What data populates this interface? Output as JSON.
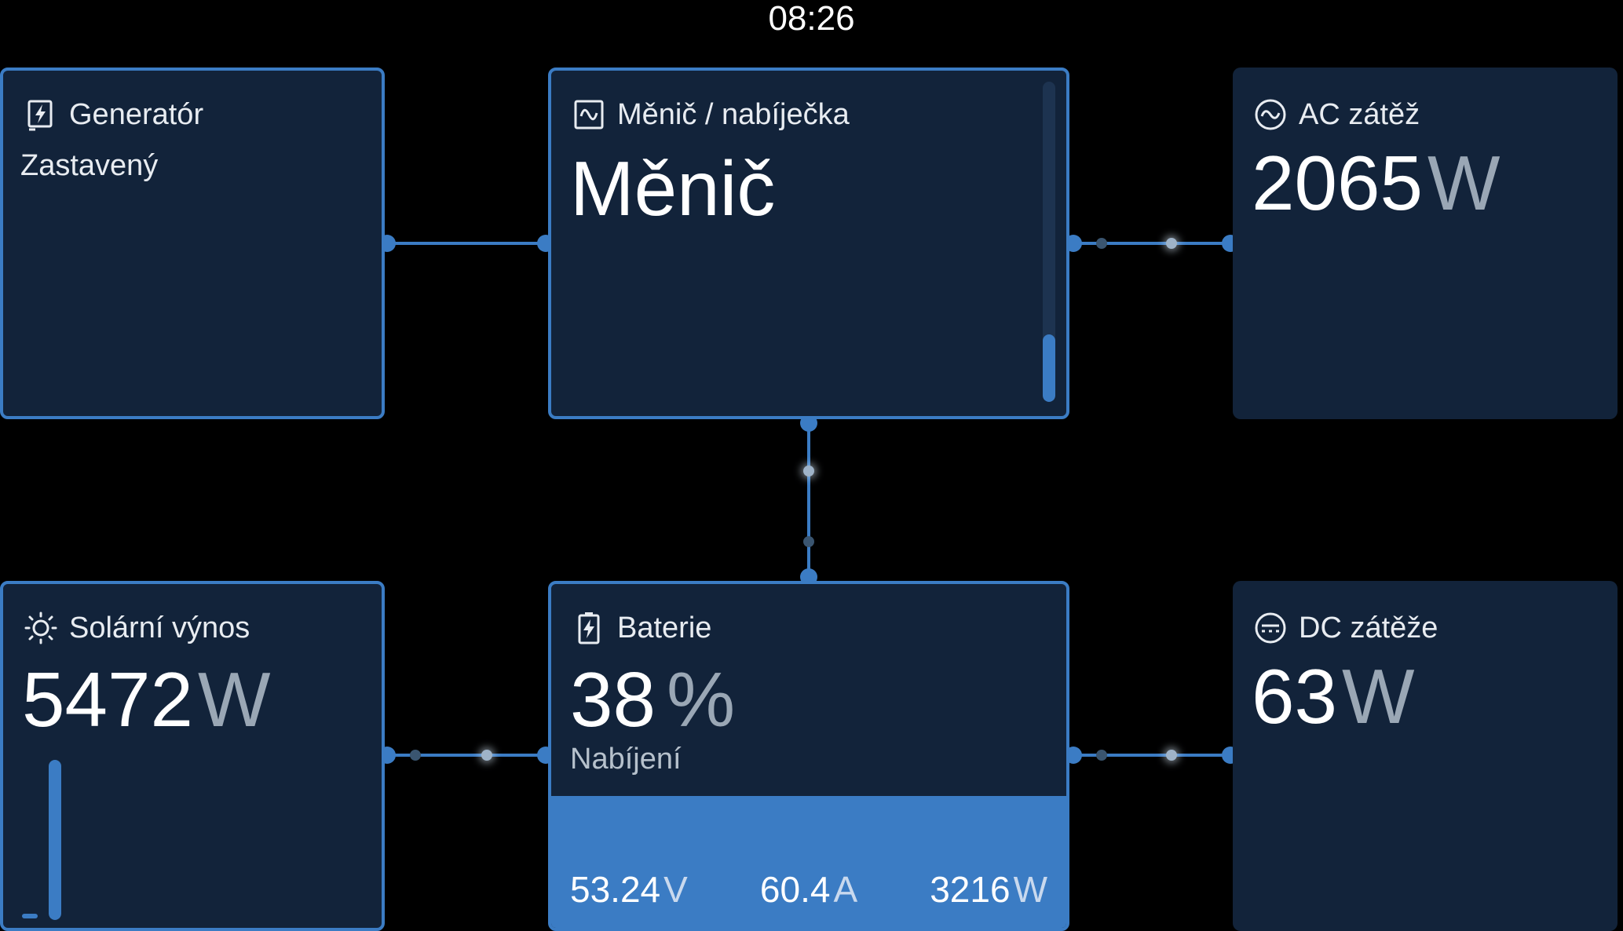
{
  "status_bar": {
    "time": "08:26"
  },
  "generator": {
    "title": "Generatór",
    "icon": "generator-icon",
    "status": "Zastavený"
  },
  "inverter": {
    "title": "Měnič / nabíječka",
    "icon": "inverter-icon",
    "mode": "Měnič",
    "level_fraction": 0.21
  },
  "ac_load": {
    "title": "AC zátěž",
    "icon": "ac-sine-icon",
    "value": "2065",
    "unit": "W"
  },
  "solar": {
    "title": "Solární výnos",
    "icon": "sun-icon",
    "value": "5472",
    "unit": "W",
    "level_fraction": 0.98
  },
  "battery": {
    "title": "Baterie",
    "icon": "battery-charging-icon",
    "percent": "38",
    "percent_unit": "%",
    "state": "Nabíjení",
    "voltage": "53.24",
    "voltage_unit": "V",
    "current": "60.4",
    "current_unit": "A",
    "power": "3216",
    "power_unit": "W"
  },
  "dc_load": {
    "title": "DC zátěže",
    "icon": "dc-load-icon",
    "value": "63",
    "unit": "W"
  },
  "colors": {
    "background": "#000000",
    "card": "#12233a",
    "accent": "#3b7cc4",
    "unit_gray": "#9aa7b5"
  }
}
